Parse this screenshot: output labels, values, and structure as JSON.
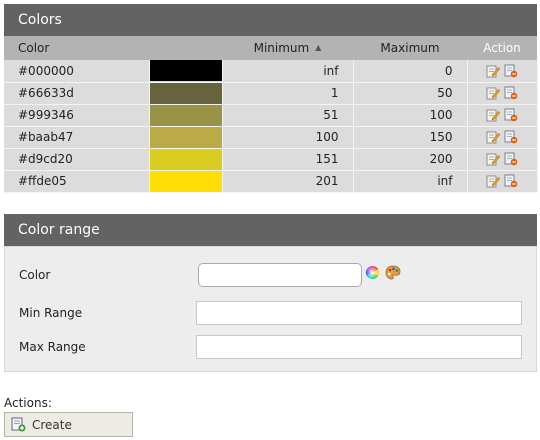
{
  "colors_panel": {
    "title": "Colors",
    "columns": {
      "color": "Color",
      "minimum": "Minimum",
      "maximum": "Maximum",
      "action": "Action"
    },
    "rows": [
      {
        "name": "#000000",
        "swatch": "#000000",
        "min": "inf",
        "max": "0"
      },
      {
        "name": "#66633d",
        "swatch": "#66633d",
        "min": "1",
        "max": "50"
      },
      {
        "name": "#999346",
        "swatch": "#999346",
        "min": "51",
        "max": "100"
      },
      {
        "name": "#baab47",
        "swatch": "#baab47",
        "min": "100",
        "max": "150"
      },
      {
        "name": "#d9cd20",
        "swatch": "#d9cd20",
        "min": "151",
        "max": "200"
      },
      {
        "name": "#ffde05",
        "swatch": "#ffde05",
        "min": "201",
        "max": "inf"
      }
    ]
  },
  "range_panel": {
    "title": "Color range",
    "color_label": "Color",
    "color_value": "",
    "min_label": "Min Range",
    "min_value": "",
    "max_label": "Max Range",
    "max_value": ""
  },
  "actions": {
    "label": "Actions:",
    "create_label": "Create"
  },
  "theme": {
    "header_bg": "#636363",
    "column_header_bg": "#b3b3b3",
    "row_bg": "#dcdcdc"
  }
}
